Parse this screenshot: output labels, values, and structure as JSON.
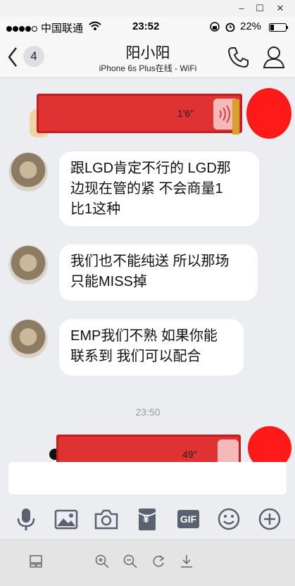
{
  "status": {
    "carrier": "中国联通",
    "time": "23:52",
    "battery": "22%"
  },
  "nav": {
    "unread_count": "4",
    "contact_name": "阳小阳",
    "contact_status": "iPhone 6s Plus在线 - WiFi"
  },
  "messages": [
    {
      "type": "voice",
      "side": "right",
      "duration": "1'6''"
    },
    {
      "type": "text",
      "side": "left",
      "lines": [
        "跟LGD肯定不行的 LGD那",
        "边现在管的紧 不会商量1",
        "比1这种"
      ]
    },
    {
      "type": "text",
      "side": "left",
      "lines": [
        "我们也不能纯送 所以那场",
        "只能MISS掉"
      ]
    },
    {
      "type": "text",
      "side": "left",
      "lines": [
        "EMP我们不熟 如果你能",
        "联系到 我们可以配合"
      ]
    },
    {
      "type": "time",
      "text": "23:50"
    },
    {
      "type": "voice",
      "side": "right",
      "duration": "49''"
    }
  ],
  "toolbar": {
    "gif_label": "GIF",
    "yen_label": "¥"
  },
  "colors": {
    "accent_red": "#e03232",
    "bubble": "#ffffff",
    "background": "#ebedf0"
  }
}
